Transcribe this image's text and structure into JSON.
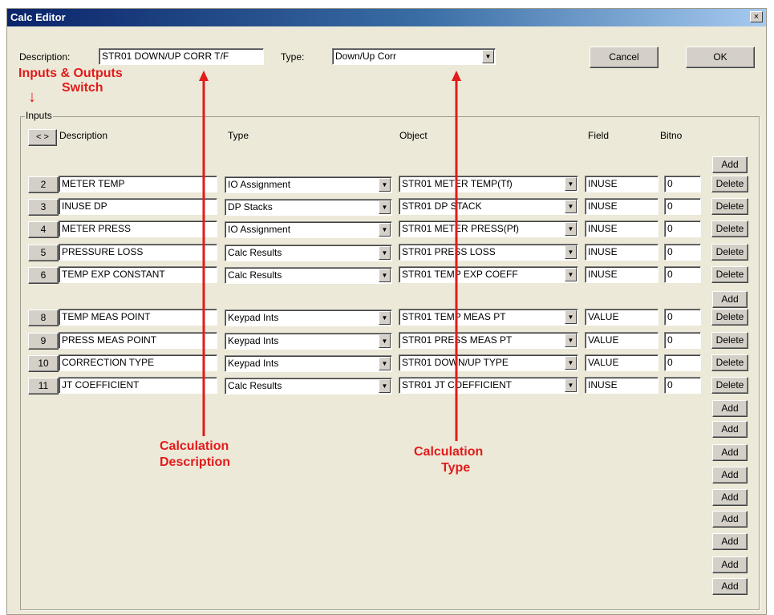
{
  "window": {
    "title": "Calc Editor",
    "close_glyph": "×"
  },
  "header": {
    "description_label": "Description:",
    "description_value": "STR01 DOWN/UP CORR T/F",
    "type_label": "Type:",
    "type_value": "Down/Up Corr",
    "cancel_label": "Cancel",
    "ok_label": "OK"
  },
  "inputs": {
    "group_label": "Inputs",
    "switch_label": "< >",
    "columns": {
      "description": "Description",
      "type": "Type",
      "object": "Object",
      "field": "Field",
      "bitno": "Bitno"
    },
    "rows": [
      {
        "num": "2",
        "description": "METER TEMP",
        "type": "IO Assignment",
        "object": "STR01 METER TEMP(Tf)",
        "field": "INUSE",
        "bitno": "0"
      },
      {
        "num": "3",
        "description": "INUSE DP",
        "type": "DP Stacks",
        "object": "STR01 DP STACK",
        "field": "INUSE",
        "bitno": "0"
      },
      {
        "num": "4",
        "description": "METER PRESS",
        "type": "IO Assignment",
        "object": "STR01 METER PRESS(Pf)",
        "field": "INUSE",
        "bitno": "0"
      },
      {
        "num": "5",
        "description": "PRESSURE LOSS",
        "type": "Calc Results",
        "object": "STR01 PRESS LOSS",
        "field": "INUSE",
        "bitno": "0"
      },
      {
        "num": "6",
        "description": "TEMP EXP CONSTANT",
        "type": "Calc Results",
        "object": "STR01 TEMP EXP COEFF",
        "field": "INUSE",
        "bitno": "0"
      },
      {
        "num": "8",
        "description": "TEMP MEAS POINT",
        "type": "Keypad Ints",
        "object": "STR01 TEMP MEAS PT",
        "field": "VALUE",
        "bitno": "0"
      },
      {
        "num": "9",
        "description": "PRESS MEAS POINT",
        "type": "Keypad Ints",
        "object": "STR01 PRESS MEAS PT",
        "field": "VALUE",
        "bitno": "0"
      },
      {
        "num": "10",
        "description": "CORRECTION TYPE",
        "type": "Keypad Ints",
        "object": "STR01 DOWN/UP TYPE",
        "field": "VALUE",
        "bitno": "0"
      },
      {
        "num": "11",
        "description": "JT COEFFICIENT",
        "type": "Calc Results",
        "object": "STR01 JT COEFFICIENT",
        "field": "INUSE",
        "bitno": "0"
      }
    ],
    "add_label": "Add",
    "delete_label": "Delete"
  },
  "annotations": {
    "switch_line1": "Inputs & Outputs",
    "switch_line2": "Switch",
    "desc_line1": "Calculation",
    "desc_line2": "Description",
    "type_line1": "Calculation",
    "type_line2": "Type",
    "arrow_color": "#e21b1b",
    "down_arrow_glyph": "↓"
  },
  "colors": {
    "dialog_bg": "#ece9d8",
    "title_start": "#0a246a",
    "title_end": "#a6caf0",
    "annotation": "#e21b1b"
  }
}
